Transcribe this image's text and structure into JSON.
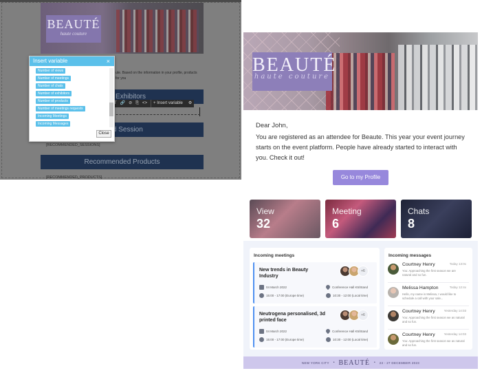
{
  "editor": {
    "banner": {
      "brand": "BEAUTÉ",
      "tagline": "haute couture"
    },
    "intro_text": "ute. Based on the information in your profile, products for you",
    "buttons": [
      "nded Exhibitors",
      "nded Session",
      "Recommended Products"
    ],
    "placeholders": [
      "[RECOMMENDED_SESSIONS]",
      "[RECOMMENDED_PRODUCTS]"
    ],
    "toolbar": {
      "items": [
        "nts",
        "T",
        "🔗",
        "⊘",
        "⎘",
        "<>"
      ],
      "insert_label": "+ Insert variable",
      "gear": "⚙"
    },
    "dialog": {
      "title": "Insert variable",
      "close_x": "×",
      "variables": [
        "Number of views",
        "Number of meetings",
        "Number of chats",
        "Number of exhibitors",
        "Number of products",
        "Number of meetings requests",
        "Incoming Meetings",
        "Incoming Messages"
      ],
      "close_label": "Close"
    }
  },
  "email": {
    "hero": {
      "brand": "BEAUTÉ",
      "tagline": "haute couture"
    },
    "greeting": "Dear John,",
    "intro": "You are registered as an attendee for Beaute. This year your event journey starts on the event platform. People have already started to interact with you. Check it out!",
    "profile_button": "Go to my Profile",
    "stats": [
      {
        "label": "View",
        "value": "32"
      },
      {
        "label": "Meeting",
        "value": "6"
      },
      {
        "label": "Chats",
        "value": "8"
      }
    ],
    "meetings": {
      "title": "Incoming meetings",
      "items": [
        {
          "title": "New trends in Beauty Industry",
          "more": "+6",
          "date": "04 March 2022",
          "location": "Conference Hall K5/Stand",
          "time_local": "15:00 - 17:00  (Europe time)",
          "time_alt": "10:30 - 12:00  (Local time)"
        },
        {
          "title": "Neutrogena personalised, 3d printed face",
          "more": "+6",
          "date": "04 March 2022",
          "location": "Conference Hall K5/Stand",
          "time_local": "15:00 - 17:00  (Europe time)",
          "time_alt": "10:30 - 12:00  (Local time)"
        }
      ]
    },
    "messages": {
      "title": "Incoming messages",
      "items": [
        {
          "name": "Courtney Henry",
          "time": "Today 13:0x",
          "preview": "You: Approaching the first season we are natural and so fun."
        },
        {
          "name": "Melissa Hampton",
          "time": "Today 12:4x",
          "preview": "Hello, my name is Melissa, I would like to schedule a call with your sale..."
        },
        {
          "name": "Courtney Henry",
          "time": "Yesterday 14:03",
          "preview": "You: Approaching the first season we as natural and so fun."
        },
        {
          "name": "Courtney Henry",
          "time": "Yesterday 14:03",
          "preview": "You: Approaching the first season we as natural and so fun."
        }
      ]
    },
    "footer": {
      "city": "NEW YORK CITY",
      "brand": "BEAUTÉ",
      "dates": "23 - 27 DECEMBER 2023",
      "dot": "•"
    }
  }
}
